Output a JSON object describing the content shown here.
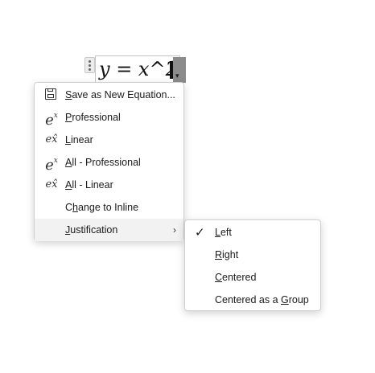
{
  "equation": {
    "text": "y = x^2",
    "dropdown_icon": "chevron-down-icon"
  },
  "context_menu": {
    "items": [
      {
        "pre": "",
        "acc": "S",
        "post": "ave as New Equation...",
        "icon": "save-icon"
      },
      {
        "pre": "",
        "acc": "P",
        "post": "rofessional",
        "icon": "professional-format-icon"
      },
      {
        "pre": "",
        "acc": "L",
        "post": "inear",
        "icon": "linear-format-icon"
      },
      {
        "pre": "",
        "acc": "A",
        "post": "ll - Professional",
        "icon": "professional-format-icon"
      },
      {
        "pre": "",
        "acc": "A",
        "post": "ll - Linear",
        "icon": "linear-format-icon"
      },
      {
        "pre": "C",
        "acc": "h",
        "post": "ange to Inline",
        "icon": ""
      },
      {
        "pre": "",
        "acc": "J",
        "post": "ustification",
        "icon": "chevron-right-icon"
      }
    ]
  },
  "justification_menu": {
    "items": [
      {
        "pre": "",
        "acc": "L",
        "post": "eft",
        "checked": true
      },
      {
        "pre": "",
        "acc": "R",
        "post": "ight",
        "checked": false
      },
      {
        "pre": "",
        "acc": "C",
        "post": "entered",
        "checked": false
      },
      {
        "pre": "Centered as a ",
        "acc": "G",
        "post": "roup",
        "checked": false
      }
    ]
  },
  "glyphs": {
    "e": "e",
    "x": "x",
    "hat_x": "x̂",
    "check": "✓",
    "chevron_right": "›",
    "chevron_down": "▾"
  }
}
